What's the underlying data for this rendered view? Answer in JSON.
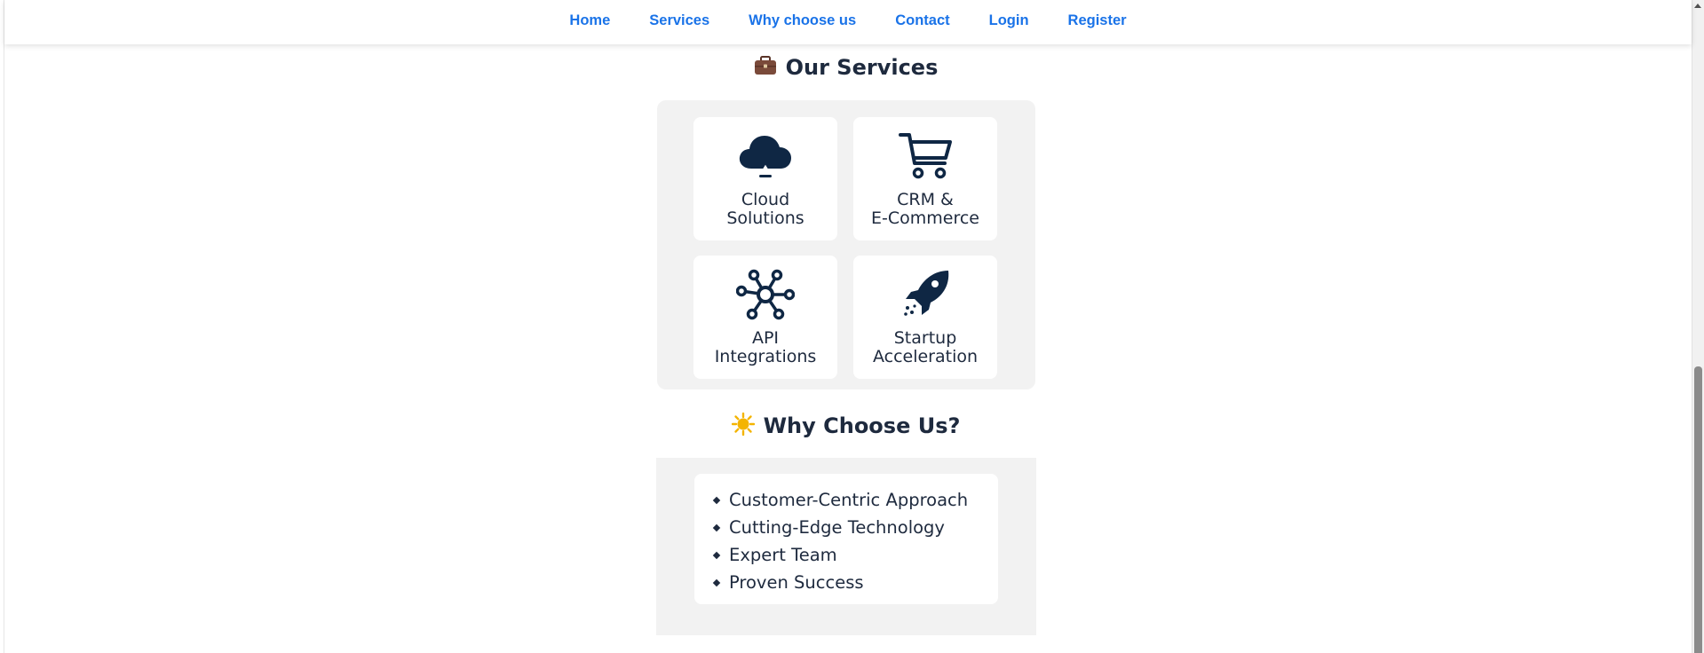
{
  "nav": {
    "links": [
      "Home",
      "Services",
      "Why choose us",
      "Contact",
      "Login",
      "Register"
    ]
  },
  "services": {
    "heading": "Our Services",
    "heading_icon": "briefcase-icon",
    "cards": [
      {
        "icon": "cloud-icon",
        "line1": "Cloud",
        "line2": "Solutions"
      },
      {
        "icon": "shopping-cart-icon",
        "line1": "CRM &",
        "line2": "E-Commerce"
      },
      {
        "icon": "network-hub-icon",
        "line1": "API",
        "line2": "Integrations"
      },
      {
        "icon": "rocket-icon",
        "line1": "Startup",
        "line2": "Acceleration"
      }
    ]
  },
  "why": {
    "heading": "Why Choose Us?",
    "heading_icon": "sun-icon",
    "items": [
      "Customer-Centric Approach",
      "Cutting-Edge Technology",
      "Expert Team",
      "Proven Success"
    ]
  },
  "colors": {
    "nav_link": "#1a73e8",
    "text_dark": "#1e2a3e",
    "icon_navy": "#0f2744",
    "panel_bg": "#f2f2f2",
    "sun": "#f4b400",
    "briefcase": "#7a4a3a"
  }
}
